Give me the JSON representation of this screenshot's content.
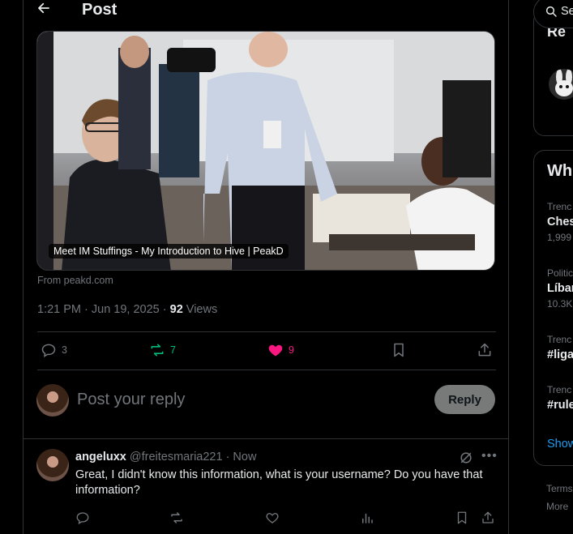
{
  "header": {
    "title": "Post"
  },
  "card": {
    "caption": "Meet IM Stuffings - My Introduction to Hive | PeakD",
    "source": "From peakd.com"
  },
  "meta": {
    "timestamp": "1:21 PM · Jun 19, 2025 · ",
    "views_count": "92",
    "views_label": "Views"
  },
  "actions": {
    "replies": "3",
    "reposts": "7",
    "likes": "9",
    "colors": {
      "repost": "#00ba7c",
      "like": "#f91880",
      "default": "#71767b"
    }
  },
  "reply_box": {
    "placeholder": "Post your reply",
    "button": "Reply"
  },
  "comment": {
    "name": "angeluxx",
    "handle": "@freitesmaria221 · Now",
    "text": "Great, I didn't know this information, what is your username? Do you have that information?"
  },
  "right": {
    "search_text": "Se",
    "panel1_title": "Re",
    "panel2_title": "Wh",
    "trends": [
      {
        "cat": "Trenc",
        "name": "Ches",
        "count": "1,999"
      },
      {
        "cat": "Politic",
        "name": "Líbar",
        "count": "10.3K"
      },
      {
        "cat": "Trenc",
        "name": "#liga",
        "count": ""
      },
      {
        "cat": "Trenc",
        "name": "#rule",
        "count": ""
      }
    ],
    "show_more": "Show",
    "footer": [
      "Terms",
      "More"
    ]
  }
}
